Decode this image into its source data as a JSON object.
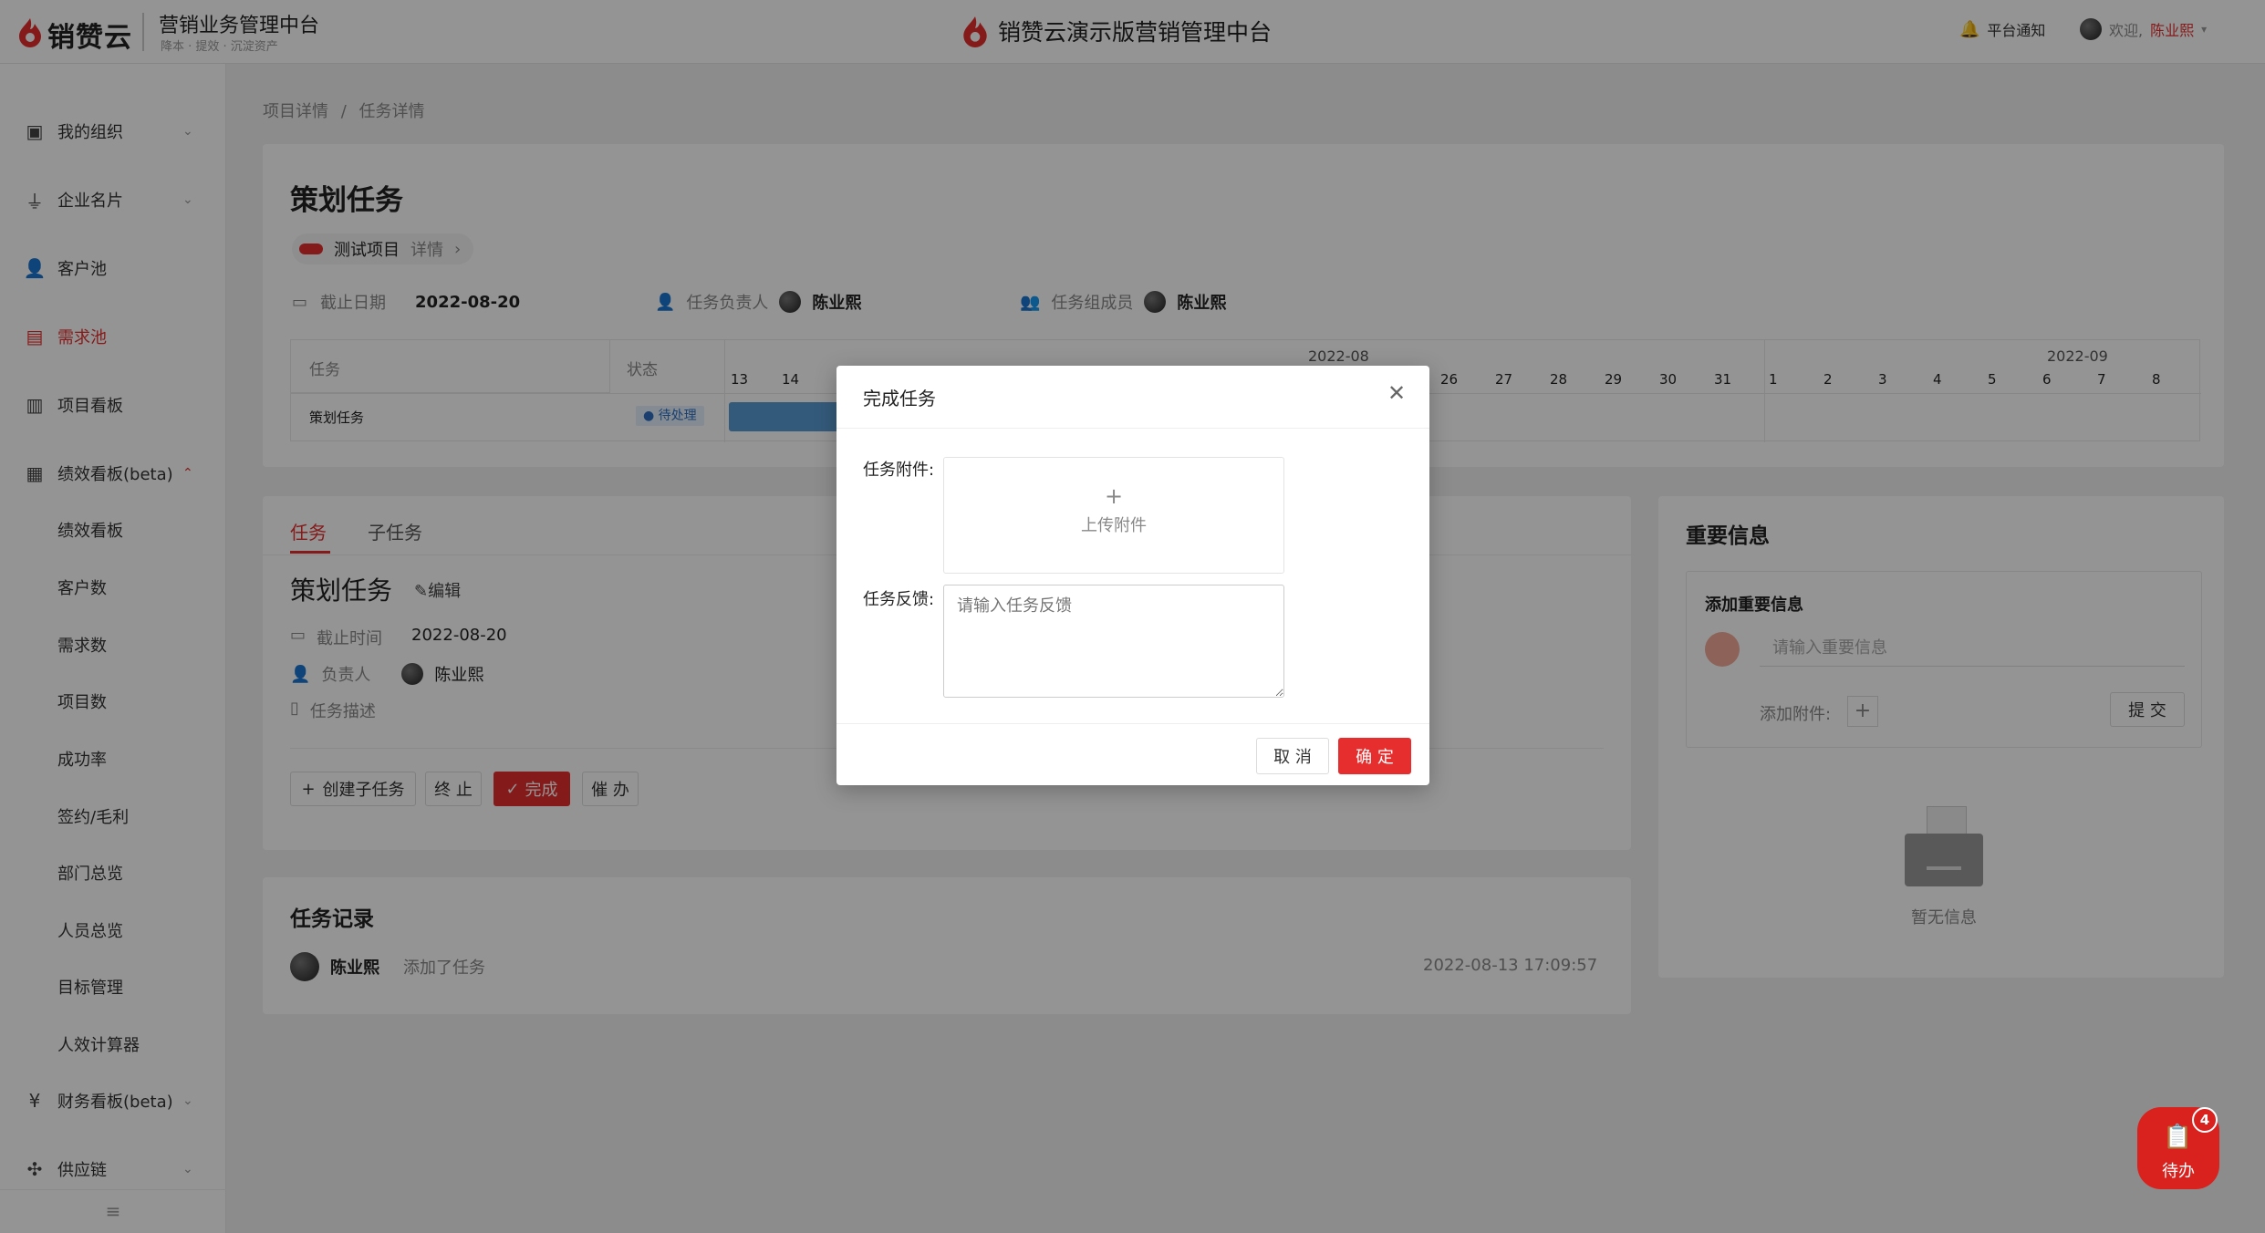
{
  "header": {
    "logo_text": "销赞云",
    "system_title": "营销业务管理中台",
    "system_tagline": "降本 · 提效 · 沉淀资产",
    "center_title": "销赞云演示版营销管理中台",
    "notice_label": "平台通知",
    "welcome_label": "欢迎,",
    "user_name": "陈业熙"
  },
  "sidebar": {
    "items": [
      {
        "label": "我的组织",
        "icon": "org-icon"
      },
      {
        "label": "企业名片",
        "icon": "building-icon"
      },
      {
        "label": "客户池",
        "icon": "user-icon"
      },
      {
        "label": "需求池",
        "icon": "doc-icon"
      },
      {
        "label": "项目看板",
        "icon": "board-icon"
      },
      {
        "label": "绩效看板(beta)",
        "icon": "chart-icon"
      },
      {
        "label": "财务看板(beta)",
        "icon": "yen-icon"
      },
      {
        "label": "供应链",
        "icon": "network-icon"
      }
    ],
    "sub_items": [
      "绩效看板",
      "客户数",
      "需求数",
      "项目数",
      "成功率",
      "签约/毛利",
      "部门总览",
      "人员总览",
      "目标管理",
      "人效计算器"
    ]
  },
  "breadcrumb": {
    "parent": "项目详情",
    "separator": "/",
    "current": "任务详情"
  },
  "task_header": {
    "title": "策划任务",
    "project_name": "测试项目",
    "project_detail": "详情",
    "deadline_label": "截止日期",
    "deadline_value": "2022-08-20",
    "owner_label": "任务负责人",
    "owner_name": "陈业熙",
    "members_label": "任务组成员",
    "member_name": "陈业熙"
  },
  "gantt": {
    "col_task": "任务",
    "col_status": "状态",
    "month_aug": "2022-08",
    "month_sep": "2022-09",
    "days_left": [
      "13",
      "14"
    ],
    "days_right": [
      "26",
      "27",
      "28",
      "29",
      "30",
      "31",
      "1",
      "2",
      "3",
      "4",
      "5",
      "6",
      "7",
      "8"
    ],
    "row_task": "策划任务",
    "row_status": "待处理"
  },
  "task_panel": {
    "tab_task": "任务",
    "tab_subtask": "子任务",
    "title": "策划任务",
    "edit_label": "编辑",
    "deadline_label": "截止时间",
    "deadline_value": "2022-08-20",
    "owner_label": "负责人",
    "owner_name": "陈业熙",
    "desc_label": "任务描述",
    "btn_create_sub": "创建子任务",
    "btn_stop": "终 止",
    "btn_done": "完成",
    "btn_urge": "催 办"
  },
  "records": {
    "title": "任务记录",
    "user": "陈业熙",
    "action": "添加了任务",
    "time": "2022-08-13 17:09:57"
  },
  "important": {
    "title": "重要信息",
    "add_title": "添加重要信息",
    "input_placeholder": "请输入重要信息",
    "attach_label": "添加附件:",
    "submit_label": "提 交",
    "empty_label": "暂无信息"
  },
  "modal": {
    "title": "完成任务",
    "attach_label": "任务附件:",
    "upload_plus": "+",
    "upload_label": "上传附件",
    "feedback_label": "任务反馈:",
    "feedback_placeholder": "请输入任务反馈",
    "cancel_label": "取 消",
    "confirm_label": "确 定"
  },
  "fab": {
    "label": "待办",
    "badge": "4"
  },
  "colors": {
    "accent": "#e62e2e",
    "gantt_bar": "#5b9bd5"
  }
}
